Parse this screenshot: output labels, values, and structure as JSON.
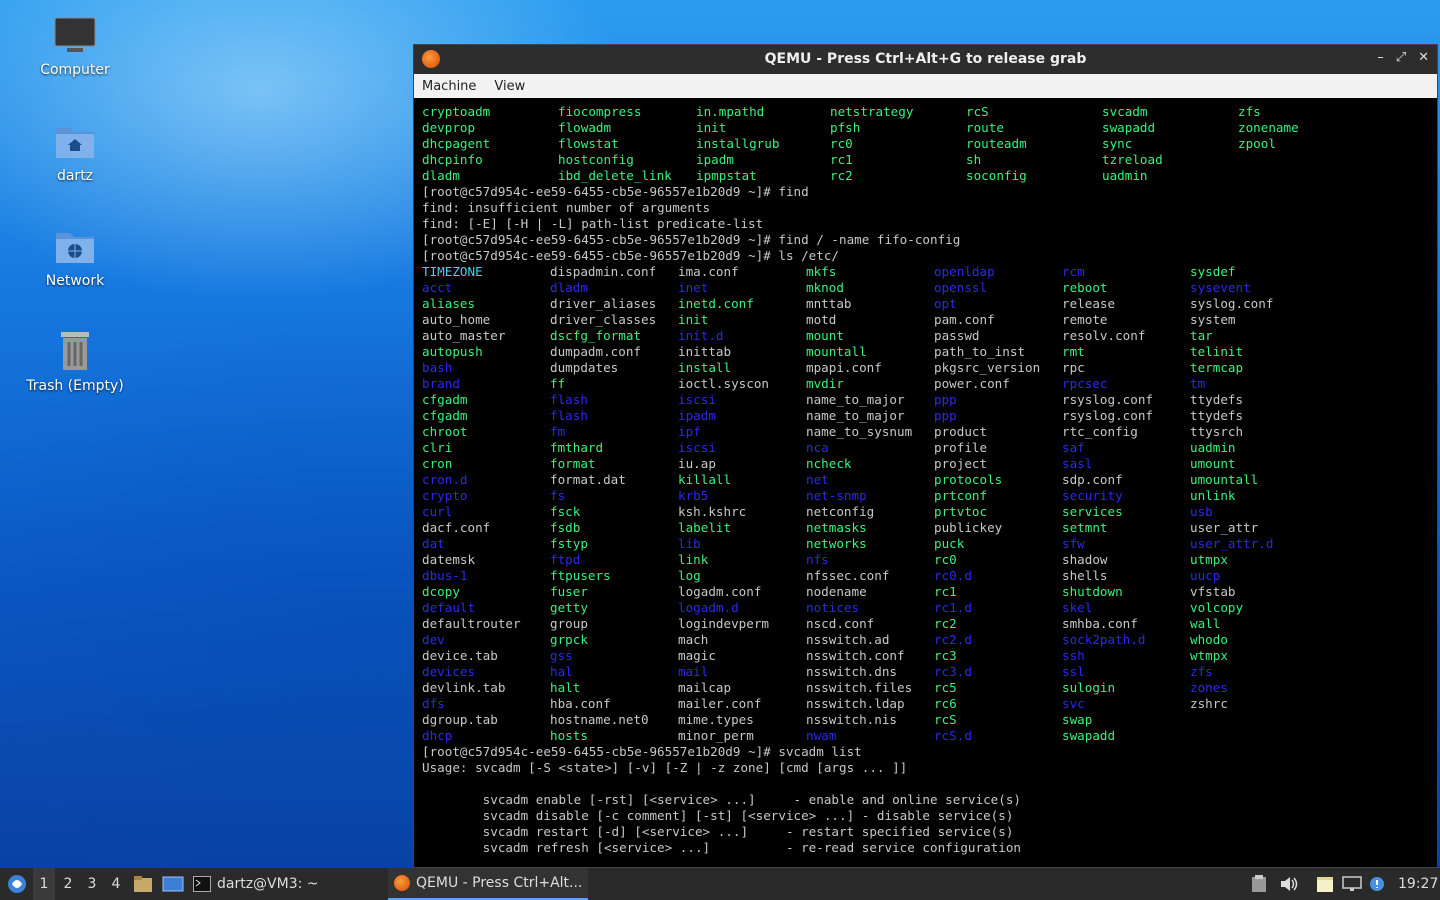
{
  "desktop": {
    "icons": [
      {
        "label": "Computer",
        "icon": "computer-icon"
      },
      {
        "label": "dartz",
        "icon": "home-folder-icon"
      },
      {
        "label": "Network",
        "icon": "network-folder-icon"
      },
      {
        "label": "Trash (Empty)",
        "icon": "trash-icon"
      }
    ]
  },
  "window": {
    "title": "QEMU - Press Ctrl+Alt+G to release grab",
    "menu": [
      "Machine",
      "View"
    ],
    "buttons": {
      "minimize": "–",
      "maximize": "⤢",
      "close": "✕"
    }
  },
  "terminal": {
    "colors": {
      "exe": "#3cf07a",
      "dir": "#2a2ae8",
      "link": "#41d5ee",
      "file": "#c8c8c8"
    },
    "sbin_rows": [
      [
        "cryptoadm",
        "fiocompress",
        "in.mpathd",
        "netstrategy",
        "rcS",
        "svcadm",
        "zfs"
      ],
      [
        "devprop",
        "flowadm",
        "init",
        "pfsh",
        "route",
        "swapadd",
        "zonename"
      ],
      [
        "dhcpagent",
        "flowstat",
        "installgrub",
        "rc0",
        "routeadm",
        "sync",
        "zpool"
      ],
      [
        "dhcpinfo",
        "hostconfig",
        "ipadm",
        "rc1",
        "sh",
        "tzreload",
        ""
      ],
      [
        "dladm",
        "ibd_delete_link",
        "ipmpstat",
        "rc2",
        "soconfig",
        "uadmin",
        ""
      ]
    ],
    "cmd_lines": [
      "[root@c57d954c-ee59-6455-cb5e-96557e1b20d9 ~]# find",
      "find: insufficient number of arguments",
      "find: [-E] [-H | -L] path-list predicate-list",
      "[root@c57d954c-ee59-6455-cb5e-96557e1b20d9 ~]# find / -name fifo-config",
      "[root@c57d954c-ee59-6455-cb5e-96557e1b20d9 ~]# ls /etc/"
    ],
    "etc_columns": [
      [
        [
          "TIMEZONE",
          "cyan"
        ],
        [
          "acct",
          "dir"
        ],
        [
          "aliases",
          "exe"
        ],
        [
          "auto_home",
          "file"
        ],
        [
          "auto_master",
          "file"
        ],
        [
          "autopush",
          "exe"
        ],
        [
          "bash",
          "dir"
        ],
        [
          "brand",
          "dir"
        ],
        [
          "cfgadm",
          "exe"
        ],
        [
          "cfgadm",
          "exe"
        ],
        [
          "chroot",
          "exe"
        ],
        [
          "clri",
          "exe"
        ],
        [
          "cron",
          "exe"
        ],
        [
          "cron.d",
          "dir"
        ],
        [
          "crypto",
          "dir"
        ],
        [
          "curl",
          "dir"
        ],
        [
          "dacf.conf",
          "file"
        ],
        [
          "dat",
          "dir"
        ],
        [
          "datemsk",
          "file"
        ],
        [
          "dbus-1",
          "dir"
        ],
        [
          "dcopy",
          "exe"
        ],
        [
          "default",
          "dir"
        ],
        [
          "defaultrouter",
          "file"
        ],
        [
          "dev",
          "dir"
        ],
        [
          "device.tab",
          "file"
        ],
        [
          "devices",
          "dir"
        ],
        [
          "devlink.tab",
          "file"
        ],
        [
          "dfs",
          "dir"
        ],
        [
          "dgroup.tab",
          "file"
        ],
        [
          "dhcp",
          "dir"
        ]
      ],
      [
        [
          "dispadmin.conf",
          "file"
        ],
        [
          "dladm",
          "dir"
        ],
        [
          "driver_aliases",
          "file"
        ],
        [
          "driver_classes",
          "file"
        ],
        [
          "dscfg_format",
          "exe"
        ],
        [
          "dumpadm.conf",
          "file"
        ],
        [
          "dumpdates",
          "file"
        ],
        [
          "ff",
          "exe"
        ],
        [
          "flash",
          "dir"
        ],
        [
          "flash",
          "dir"
        ],
        [
          "fm",
          "dir"
        ],
        [
          "fmthard",
          "exe"
        ],
        [
          "format",
          "exe"
        ],
        [
          "format.dat",
          "file"
        ],
        [
          "fs",
          "dir"
        ],
        [
          "fsck",
          "exe"
        ],
        [
          "fsdb",
          "exe"
        ],
        [
          "fstyp",
          "exe"
        ],
        [
          "ftpd",
          "dir"
        ],
        [
          "ftpusers",
          "exe"
        ],
        [
          "fuser",
          "exe"
        ],
        [
          "getty",
          "exe"
        ],
        [
          "group",
          "file"
        ],
        [
          "grpck",
          "exe"
        ],
        [
          "gss",
          "dir"
        ],
        [
          "hal",
          "dir"
        ],
        [
          "halt",
          "exe"
        ],
        [
          "hba.conf",
          "file"
        ],
        [
          "hostname.net0",
          "file"
        ],
        [
          "hosts",
          "exe"
        ]
      ],
      [
        [
          "ima.conf",
          "file"
        ],
        [
          "inet",
          "dir"
        ],
        [
          "inetd.conf",
          "exe"
        ],
        [
          "init",
          "exe"
        ],
        [
          "init.d",
          "dir"
        ],
        [
          "inittab",
          "file"
        ],
        [
          "install",
          "exe"
        ],
        [
          "ioctl.syscon",
          "file"
        ],
        [
          "iscsi",
          "dir"
        ],
        [
          "ipadm",
          "dir"
        ],
        [
          "ipf",
          "dir"
        ],
        [
          "iscsi",
          "dir"
        ],
        [
          "iu.ap",
          "file"
        ],
        [
          "killall",
          "exe"
        ],
        [
          "krb5",
          "dir"
        ],
        [
          "ksh.kshrc",
          "file"
        ],
        [
          "labelit",
          "exe"
        ],
        [
          "lib",
          "dir"
        ],
        [
          "link",
          "exe"
        ],
        [
          "log",
          "exe"
        ],
        [
          "logadm.conf",
          "file"
        ],
        [
          "logadm.d",
          "dir"
        ],
        [
          "logindevperm",
          "file"
        ],
        [
          "mach",
          "file"
        ],
        [
          "magic",
          "file"
        ],
        [
          "mail",
          "dir"
        ],
        [
          "mailcap",
          "file"
        ],
        [
          "mailer.conf",
          "file"
        ],
        [
          "mime.types",
          "file"
        ],
        [
          "minor_perm",
          "file"
        ]
      ],
      [
        [
          "mkfs",
          "exe"
        ],
        [
          "mknod",
          "exe"
        ],
        [
          "mnttab",
          "file"
        ],
        [
          "motd",
          "file"
        ],
        [
          "mount",
          "exe"
        ],
        [
          "mountall",
          "exe"
        ],
        [
          "mpapi.conf",
          "file"
        ],
        [
          "mvdir",
          "exe"
        ],
        [
          "name_to_major",
          "file"
        ],
        [
          "name_to_major",
          "file"
        ],
        [
          "name_to_sysnum",
          "file"
        ],
        [
          "nca",
          "dir"
        ],
        [
          "ncheck",
          "exe"
        ],
        [
          "net",
          "dir"
        ],
        [
          "net-snmp",
          "dir"
        ],
        [
          "netconfig",
          "file"
        ],
        [
          "netmasks",
          "exe"
        ],
        [
          "networks",
          "exe"
        ],
        [
          "nfs",
          "dir"
        ],
        [
          "nfssec.conf",
          "file"
        ],
        [
          "nodename",
          "file"
        ],
        [
          "notices",
          "dir"
        ],
        [
          "nscd.conf",
          "file"
        ],
        [
          "nsswitch.ad",
          "file"
        ],
        [
          "nsswitch.conf",
          "file"
        ],
        [
          "nsswitch.dns",
          "file"
        ],
        [
          "nsswitch.files",
          "file"
        ],
        [
          "nsswitch.ldap",
          "file"
        ],
        [
          "nsswitch.nis",
          "file"
        ],
        [
          "nwam",
          "dir"
        ]
      ],
      [
        [
          "openldap",
          "dir"
        ],
        [
          "openssl",
          "dir"
        ],
        [
          "opt",
          "dir"
        ],
        [
          "pam.conf",
          "file"
        ],
        [
          "passwd",
          "file"
        ],
        [
          "path_to_inst",
          "file"
        ],
        [
          "pkgsrc_version",
          "file"
        ],
        [
          "power.conf",
          "file"
        ],
        [
          "ppp",
          "dir"
        ],
        [
          "ppp",
          "dir"
        ],
        [
          "product",
          "file"
        ],
        [
          "profile",
          "file"
        ],
        [
          "project",
          "file"
        ],
        [
          "protocols",
          "exe"
        ],
        [
          "prtconf",
          "exe"
        ],
        [
          "prtvtoc",
          "exe"
        ],
        [
          "publickey",
          "file"
        ],
        [
          "puck",
          "exe"
        ],
        [
          "rc0",
          "exe"
        ],
        [
          "rc0.d",
          "dir"
        ],
        [
          "rc1",
          "exe"
        ],
        [
          "rc1.d",
          "dir"
        ],
        [
          "rc2",
          "exe"
        ],
        [
          "rc2.d",
          "dir"
        ],
        [
          "rc3",
          "exe"
        ],
        [
          "rc3.d",
          "dir"
        ],
        [
          "rc5",
          "exe"
        ],
        [
          "rc6",
          "exe"
        ],
        [
          "rcS",
          "exe"
        ],
        [
          "rcS.d",
          "dir"
        ]
      ],
      [
        [
          "rcm",
          "dir"
        ],
        [
          "reboot",
          "exe"
        ],
        [
          "release",
          "file"
        ],
        [
          "remote",
          "file"
        ],
        [
          "resolv.conf",
          "file"
        ],
        [
          "rmt",
          "exe"
        ],
        [
          "rpc",
          "file"
        ],
        [
          "rpcsec",
          "dir"
        ],
        [
          "rsyslog.conf",
          "file"
        ],
        [
          "rsyslog.conf",
          "file"
        ],
        [
          "rtc_config",
          "file"
        ],
        [
          "saf",
          "dir"
        ],
        [
          "sasl",
          "dir"
        ],
        [
          "sdp.conf",
          "file"
        ],
        [
          "security",
          "dir"
        ],
        [
          "services",
          "exe"
        ],
        [
          "setmnt",
          "exe"
        ],
        [
          "sfw",
          "dir"
        ],
        [
          "shadow",
          "file"
        ],
        [
          "shells",
          "file"
        ],
        [
          "shutdown",
          "exe"
        ],
        [
          "skel",
          "dir"
        ],
        [
          "smhba.conf",
          "file"
        ],
        [
          "sock2path.d",
          "dir"
        ],
        [
          "ssh",
          "dir"
        ],
        [
          "ssl",
          "dir"
        ],
        [
          "sulogin",
          "exe"
        ],
        [
          "svc",
          "dir"
        ],
        [
          "swap",
          "exe"
        ],
        [
          "swapadd",
          "exe"
        ]
      ],
      [
        [
          "sysdef",
          "exe"
        ],
        [
          "sysevent",
          "dir"
        ],
        [
          "syslog.conf",
          "file"
        ],
        [
          "system",
          "file"
        ],
        [
          "tar",
          "exe"
        ],
        [
          "telinit",
          "exe"
        ],
        [
          "termcap",
          "exe"
        ],
        [
          "tm",
          "dir"
        ],
        [
          "ttydefs",
          "file"
        ],
        [
          "ttydefs",
          "file"
        ],
        [
          "ttysrch",
          "file"
        ],
        [
          "uadmin",
          "exe"
        ],
        [
          "umount",
          "exe"
        ],
        [
          "umountall",
          "exe"
        ],
        [
          "unlink",
          "exe"
        ],
        [
          "usb",
          "dir"
        ],
        [
          "user_attr",
          "file"
        ],
        [
          "user_attr.d",
          "dir"
        ],
        [
          "utmpx",
          "exe"
        ],
        [
          "uucp",
          "dir"
        ],
        [
          "vfstab",
          "file"
        ],
        [
          "volcopy",
          "exe"
        ],
        [
          "wall",
          "exe"
        ],
        [
          "whodo",
          "exe"
        ],
        [
          "wtmpx",
          "exe"
        ],
        [
          "zfs",
          "dir"
        ],
        [
          "zones",
          "dir"
        ],
        [
          "zshrc",
          "file"
        ],
        [
          "",
          ""
        ],
        [
          "",
          ""
        ]
      ]
    ],
    "after_lines": [
      "[root@c57d954c-ee59-6455-cb5e-96557e1b20d9 ~]# svcadm list",
      "Usage: svcadm [-S <state>] [-v] [-Z | -z zone] [cmd [args ... ]]",
      "",
      "        svcadm enable [-rst] [<service> ...]     - enable and online service(s)",
      "        svcadm disable [-c comment] [-st] [<service> ...] - disable service(s)",
      "        svcadm restart [-d] [<service> ...]     - restart specified service(s)",
      "        svcadm refresh [<service> ...]          - re-read service configuration"
    ]
  },
  "taskbar": {
    "workspaces": [
      "1",
      "2",
      "3",
      "4"
    ],
    "terminal_task": "dartz@VM3: ~",
    "qemu_task": "QEMU - Press Ctrl+Alt...",
    "clock": "19:27"
  }
}
